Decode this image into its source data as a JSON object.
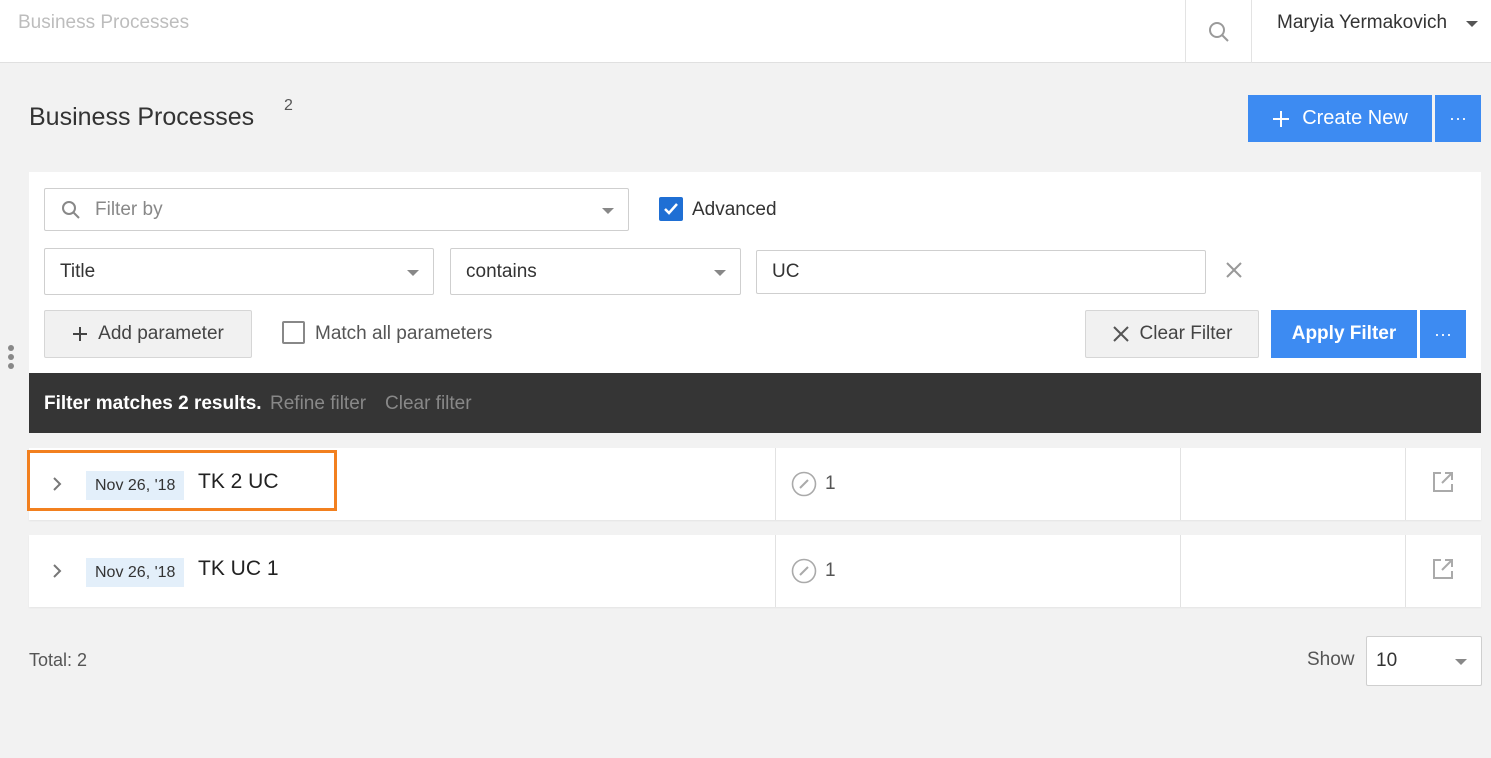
{
  "topbar": {
    "title": "Business Processes",
    "user_name": "Maryia Yermakovich"
  },
  "header": {
    "title": "Business Processes",
    "count": "2",
    "create_label": "Create New",
    "more_label": "···"
  },
  "filter": {
    "filter_by_placeholder": "Filter by",
    "advanced_label": "Advanced",
    "advanced_checked": true,
    "field_value": "Title",
    "operator_value": "contains",
    "text_value": "UC",
    "add_parameter_label": "Add parameter",
    "match_all_label": "Match all parameters",
    "match_all_checked": false,
    "clear_label": "Clear Filter",
    "apply_label": "Apply Filter",
    "more_label": "···"
  },
  "status": {
    "message": "Filter matches 2 results.",
    "refine_label": "Refine filter",
    "clear_label": "Clear filter"
  },
  "rows": [
    {
      "date": "Nov 26, '18",
      "title": "TK 2 UC",
      "count": "1"
    },
    {
      "date": "Nov 26, '18",
      "title": "TK UC 1",
      "count": "1"
    }
  ],
  "footer": {
    "total": "Total: 2",
    "show_label": "Show",
    "page_size": "10"
  },
  "colors": {
    "primary": "#3d8bf2",
    "status_bar": "#353535",
    "highlight": "#f2801f",
    "date_badge": "#e3effa"
  }
}
